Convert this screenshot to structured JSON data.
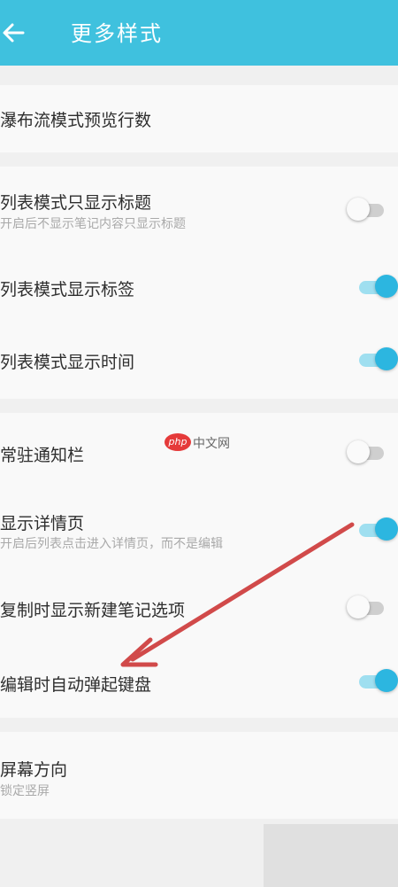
{
  "app_bar": {
    "title": "更多样式",
    "back_icon": "arrow-left-icon",
    "color": "#3fc1de"
  },
  "settings": {
    "waterfall_rows": {
      "title": "瀑布流模式预览行数"
    },
    "list_title_only": {
      "title": "列表模式只显示标题",
      "subtitle": "开启后不显示笔记内容只显示标题",
      "enabled": false
    },
    "list_show_tags": {
      "title": "列表模式显示标签",
      "enabled": true
    },
    "list_show_time": {
      "title": "列表模式显示时间",
      "enabled": true
    },
    "persistent_notification": {
      "title": "常驻通知栏",
      "enabled": false
    },
    "show_detail_page": {
      "title": "显示详情页",
      "subtitle": "开启后列表点击进入详情页，而不是编辑",
      "enabled": true
    },
    "copy_show_new_note": {
      "title": "复制时显示新建笔记选项",
      "enabled": false
    },
    "auto_keyboard": {
      "title": "编辑时自动弹起键盘",
      "enabled": true
    },
    "screen_orientation": {
      "title": "屏幕方向",
      "subtitle": "锁定竖屏"
    }
  },
  "watermark": {
    "logo": "php",
    "text": "中文网"
  },
  "colors": {
    "toggle_on": "#2cb6e0",
    "annotation_arrow": "#d14a4a"
  }
}
